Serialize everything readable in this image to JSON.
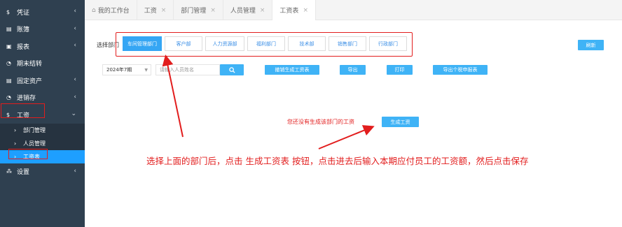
{
  "sidebar": {
    "items": [
      {
        "icon": "$",
        "label": "凭证",
        "chevron": "‹"
      },
      {
        "icon": "▤",
        "label": "账簿",
        "chevron": "‹"
      },
      {
        "icon": "▣",
        "label": "报表",
        "chevron": "‹"
      },
      {
        "icon": "◔",
        "label": "期末结转",
        "chevron": ""
      },
      {
        "icon": "▤",
        "label": "固定资产",
        "chevron": "‹"
      },
      {
        "icon": "◔",
        "label": "进销存",
        "chevron": "‹"
      },
      {
        "icon": "$",
        "label": "工资",
        "chevron": "⌄"
      }
    ],
    "sub_items": [
      {
        "arrow": "›",
        "label": "部门管理"
      },
      {
        "arrow": "›",
        "label": "人员管理"
      },
      {
        "arrow": "›",
        "label": "工资表"
      }
    ],
    "settings": {
      "icon": "⁂",
      "label": "设置",
      "chevron": "‹"
    }
  },
  "tabs": [
    {
      "label": "我的工作台",
      "close": ""
    },
    {
      "label": "工资",
      "close": "×"
    },
    {
      "label": "部门管理",
      "close": "×"
    },
    {
      "label": "人员管理",
      "close": "×"
    },
    {
      "label": "工资表",
      "close": "×"
    }
  ],
  "main": {
    "dept_label": "选择部门",
    "departments": [
      "车间管理部门",
      "客户部",
      "人力资源部",
      "福利部门",
      "技术部",
      "销售部门",
      "行政部门"
    ],
    "refresh_label": "刷新",
    "period_value": "2024年7期",
    "search_placeholder": "请输入人员姓名",
    "actions": [
      "撤销生成工资表",
      "导出",
      "打印",
      "导出个税申报表"
    ],
    "empty_message": "您还没有生成该部门的工资",
    "generate_label": "生成工资",
    "instruction": "选择上面的部门后，点击 生成工资表 按钮，点击进去后输入本期应付员工的工资额，然后点击保存"
  },
  "colors": {
    "sidebar_bg": "#2f4050",
    "accent_blue": "#3fb3f6",
    "annotation_red": "#e21d1d"
  }
}
